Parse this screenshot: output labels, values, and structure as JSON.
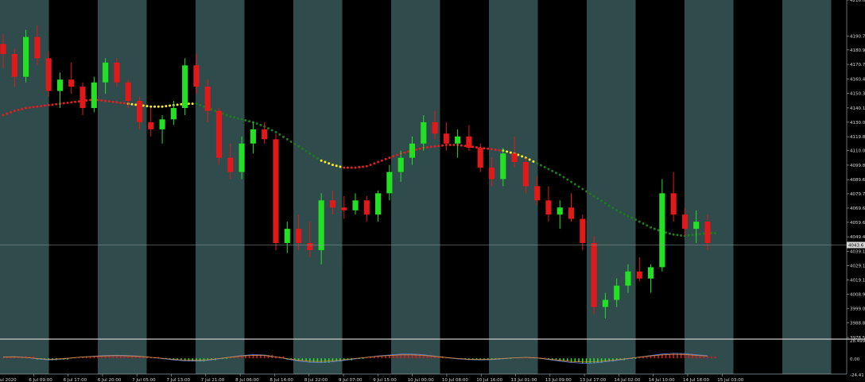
{
  "colors": {
    "background": "#000000",
    "band_light": "#2f4b4c",
    "band_dark": "#000000",
    "bull": "#24e024",
    "bear": "#e01a1a",
    "ma_up": "#e02020",
    "ma_down": "#1f7a1f",
    "ma_flat": "#ffee22",
    "axis_text": "#d6d6d6",
    "grid_line": "#8e9ea0",
    "osc_line_1": "#5b7fd6",
    "osc_line_2": "#d48a3a"
  },
  "chart_data": {
    "type": "candlestick",
    "title": "",
    "ylim": [
      3978.5,
      4216.0
    ],
    "price_ticks": [
      "4216.0",
      "4190.7",
      "4180.9",
      "4170.7",
      "4160.4",
      "4150.3",
      "4140.1",
      "4130.0",
      "4119.8",
      "4110.0",
      "4099.8",
      "4089.6",
      "4079.7",
      "4069.6",
      "4059.6",
      "4049.4",
      "4039.1",
      "4029.1",
      "4019.1",
      "4008.9",
      "3999.0",
      "3988.8",
      "3978.5"
    ],
    "current_price_label": "4043.6",
    "time_labels": [
      "6 Jul 2020",
      "6 Jul 09:00",
      "6 Jul 17:00",
      "6 Jul 20:00",
      "7 Jul 05:00",
      "7 Jul 13:00",
      "7 Jul 21:00",
      "8 Jul 06:00",
      "8 Jul 14:00",
      "8 Jul 22:00",
      "9 Jul 07:00",
      "9 Jul 15:00",
      "10 Jul 00:00",
      "10 Jul 08:00",
      "10 Jul 16:00",
      "13 Jul 01:00",
      "13 Jul 09:00",
      "13 Jul 17:00",
      "14 Jul 02:00",
      "14 Jul 10:00",
      "14 Jul 18:00",
      "15 Jul 03:00"
    ],
    "candles": [
      [
        4185,
        4192,
        4168,
        4178
      ],
      [
        4178,
        4182,
        4155,
        4162
      ],
      [
        4162,
        4195,
        4158,
        4190
      ],
      [
        4190,
        4198,
        4170,
        4175
      ],
      [
        4175,
        4180,
        4148,
        4152
      ],
      [
        4152,
        4165,
        4140,
        4160
      ],
      [
        4160,
        4172,
        4150,
        4155
      ],
      [
        4155,
        4158,
        4135,
        4140
      ],
      [
        4140,
        4162,
        4137,
        4158
      ],
      [
        4158,
        4175,
        4150,
        4172
      ],
      [
        4172,
        4175,
        4155,
        4158
      ],
      [
        4158,
        4160,
        4140,
        4145
      ],
      [
        4145,
        4148,
        4125,
        4130
      ],
      [
        4130,
        4140,
        4120,
        4125
      ],
      [
        4125,
        4135,
        4115,
        4132
      ],
      [
        4132,
        4145,
        4128,
        4140
      ],
      [
        4140,
        4175,
        4135,
        4170
      ],
      [
        4170,
        4178,
        4150,
        4155
      ],
      [
        4155,
        4160,
        4130,
        4138
      ],
      [
        4138,
        4140,
        4100,
        4105
      ],
      [
        4105,
        4115,
        4090,
        4095
      ],
      [
        4095,
        4120,
        4090,
        4115
      ],
      [
        4115,
        4130,
        4108,
        4125
      ],
      [
        4125,
        4130,
        4115,
        4118
      ],
      [
        4118,
        4122,
        4040,
        4045
      ],
      [
        4045,
        4060,
        4038,
        4055
      ],
      [
        4055,
        4065,
        4040,
        4045
      ],
      [
        4045,
        4060,
        4035,
        4040
      ],
      [
        4040,
        4080,
        4030,
        4075
      ],
      [
        4075,
        4082,
        4065,
        4070
      ],
      [
        4070,
        4078,
        4062,
        4068
      ],
      [
        4068,
        4080,
        4065,
        4075
      ],
      [
        4075,
        4078,
        4060,
        4065
      ],
      [
        4065,
        4082,
        4060,
        4080
      ],
      [
        4080,
        4100,
        4075,
        4095
      ],
      [
        4095,
        4110,
        4088,
        4105
      ],
      [
        4105,
        4120,
        4100,
        4115
      ],
      [
        4115,
        4135,
        4110,
        4130
      ],
      [
        4130,
        4138,
        4118,
        4122
      ],
      [
        4122,
        4130,
        4110,
        4115
      ],
      [
        4115,
        4125,
        4105,
        4120
      ],
      [
        4120,
        4128,
        4110,
        4112
      ],
      [
        4112,
        4115,
        4095,
        4098
      ],
      [
        4098,
        4105,
        4085,
        4090
      ],
      [
        4090,
        4112,
        4085,
        4108
      ],
      [
        4108,
        4120,
        4098,
        4102
      ],
      [
        4102,
        4105,
        4080,
        4085
      ],
      [
        4085,
        4092,
        4072,
        4075
      ],
      [
        4075,
        4085,
        4060,
        4065
      ],
      [
        4065,
        4075,
        4055,
        4070
      ],
      [
        4070,
        4080,
        4060,
        4062
      ],
      [
        4062,
        4065,
        4040,
        4045
      ],
      [
        4045,
        4050,
        3995,
        4000
      ],
      [
        4000,
        4010,
        3992,
        4005
      ],
      [
        4005,
        4020,
        4000,
        4015
      ],
      [
        4015,
        4030,
        4010,
        4025
      ],
      [
        4025,
        4035,
        4018,
        4020
      ],
      [
        4020,
        4030,
        4010,
        4028
      ],
      [
        4028,
        4090,
        4025,
        4080
      ],
      [
        4080,
        4095,
        4060,
        4065
      ],
      [
        4065,
        4070,
        4050,
        4055
      ],
      [
        4055,
        4068,
        4045,
        4060
      ],
      [
        4060,
        4065,
        4040,
        4045
      ]
    ],
    "moving_average": [
      4135,
      4138,
      4140,
      4141,
      4142,
      4143,
      4144,
      4145,
      4146,
      4145,
      4144,
      4143,
      4142,
      4141,
      4141,
      4142,
      4143,
      4143,
      4140,
      4137,
      4134,
      4132,
      4130,
      4127,
      4123,
      4118,
      4113,
      4108,
      4103,
      4100,
      4098,
      4098,
      4099,
      4102,
      4105,
      4108,
      4110,
      4112,
      4113,
      4114,
      4114,
      4113,
      4112,
      4111,
      4110,
      4108,
      4105,
      4101,
      4097,
      4093,
      4088,
      4083,
      4078,
      4073,
      4068,
      4064,
      4060,
      4056,
      4053,
      4051,
      4050,
      4051,
      4052
    ],
    "moving_average_state": [
      "up",
      "up",
      "up",
      "up",
      "up",
      "up",
      "up",
      "up",
      "up",
      "up",
      "up",
      "flat",
      "flat",
      "flat",
      "flat",
      "flat",
      "flat",
      "down",
      "down",
      "down",
      "down",
      "down",
      "down",
      "down",
      "down",
      "down",
      "down",
      "down",
      "flat",
      "flat",
      "up",
      "up",
      "up",
      "up",
      "up",
      "up",
      "up",
      "up",
      "up",
      "up",
      "up",
      "up",
      "up",
      "up",
      "flat",
      "flat",
      "flat",
      "down",
      "down",
      "down",
      "down",
      "down",
      "down",
      "down",
      "down",
      "down",
      "down",
      "down",
      "down",
      "down",
      "down",
      "down",
      "down"
    ],
    "oscillator": {
      "ylim": [
        -24.41,
        28.499
      ],
      "ticks": [
        "28.499",
        "0.00",
        "-24.41"
      ],
      "bars": [
        1.5,
        2.5,
        3,
        -2,
        -3,
        -2,
        1,
        2,
        3,
        4,
        5,
        4,
        3,
        2,
        -1,
        -2,
        -4,
        -5,
        -3,
        -1,
        2,
        4,
        6,
        5,
        3,
        -2,
        -4,
        -6,
        -7,
        -5,
        -3,
        -1,
        2,
        3,
        5,
        6,
        7,
        5,
        3,
        1,
        -1,
        -2,
        -3,
        -2,
        -1,
        1,
        2,
        1,
        -2,
        -4,
        -6,
        -8,
        -7,
        -5,
        -3,
        -1,
        2,
        4,
        6,
        8,
        7,
        5,
        3
      ]
    }
  }
}
